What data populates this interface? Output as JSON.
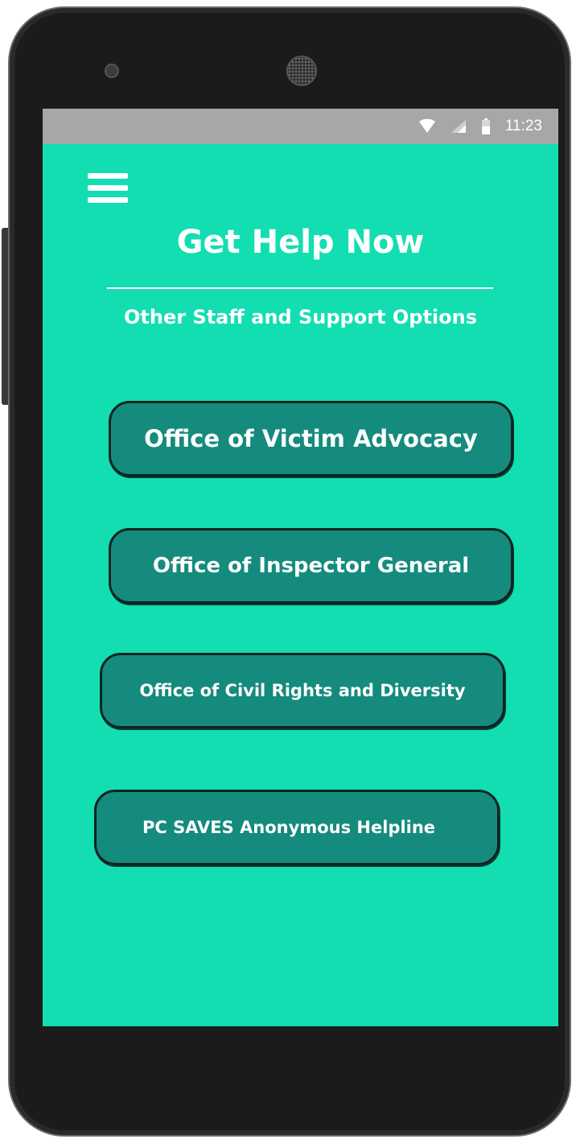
{
  "status_bar": {
    "time": "11:23",
    "icons": [
      "wifi-icon",
      "signal-icon",
      "battery-icon"
    ]
  },
  "header": {
    "menu_icon": "hamburger-menu-icon",
    "title": "Get Help Now",
    "subtitle": "Other Staff and Support Options"
  },
  "options": [
    {
      "label": "Office of Victim Advocacy"
    },
    {
      "label": "Office of Inspector General"
    },
    {
      "label": "Office of Civil Rights and Diversity"
    },
    {
      "label": "PC SAVES Anonymous Helpline"
    }
  ],
  "colors": {
    "screen_background": "#12deb1",
    "button_background": "#148b7d",
    "button_border": "#0f2420",
    "status_bar": "#a7a7a7",
    "text": "#ffffff"
  }
}
